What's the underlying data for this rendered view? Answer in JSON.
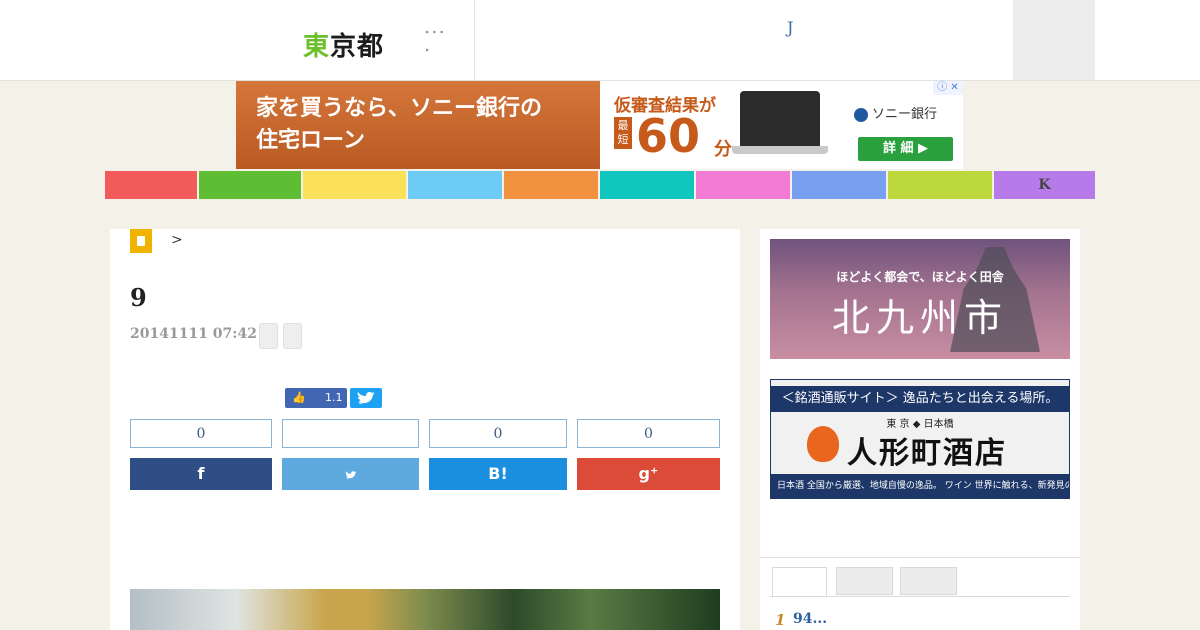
{
  "header": {
    "logo": [
      "東",
      "京都"
    ],
    "nav_triangles": [
      "‣ ‣ ‣",
      "‣"
    ],
    "center_letter": "J"
  },
  "banner_ad": {
    "left_line1": "家を買うなら、ソニー銀行の",
    "left_line2": "住宅ローン",
    "mid_lead": "仮審査結果が",
    "mid_mini": "最短",
    "mid_number": "60",
    "mid_unit": "分",
    "brand": "ソニー銀行",
    "cta": "詳 細 ▶",
    "adchoice": "ⓘ ✕"
  },
  "categories": [
    {
      "label": "",
      "color": "#f35a5a"
    },
    {
      "label": "",
      "color": "#5fbd33"
    },
    {
      "label": "",
      "color": "#fae159"
    },
    {
      "label": "",
      "color": "#6ecbf3"
    },
    {
      "label": "",
      "color": "#f2913f"
    },
    {
      "label": "",
      "color": "#10c6bf"
    },
    {
      "label": "",
      "color": "#f27bd3"
    },
    {
      "label": "",
      "color": "#79a0f0"
    },
    {
      "label": "",
      "color": "#bcd83c"
    },
    {
      "label": "K",
      "color": "#b77ae9"
    }
  ],
  "article": {
    "breadcrumb_sep": ">",
    "title": "9",
    "date": "20141111 07:42",
    "fb_like_count": "1.1",
    "counts": [
      "0",
      "",
      "0",
      "0"
    ],
    "share_icons": [
      "f",
      "🐦",
      "B!",
      "g⁺"
    ]
  },
  "sidebar": {
    "kita_small": "ほどよく都会で、ほどよく田舎",
    "kita_big": "北九州市",
    "sake_top": "＜銘酒通販サイト＞ 逸品たちと出会える場所。",
    "sake_addr": "東 京 ◆ 日本橋",
    "sake_name": "人形町酒店",
    "sake_bottom": "日本酒  全国から厳選、地域自慢の逸品。  ワイン  世界に触れる、新発見の品揃え。",
    "ranking": [
      {
        "num": "1",
        "text": "94..."
      }
    ]
  }
}
